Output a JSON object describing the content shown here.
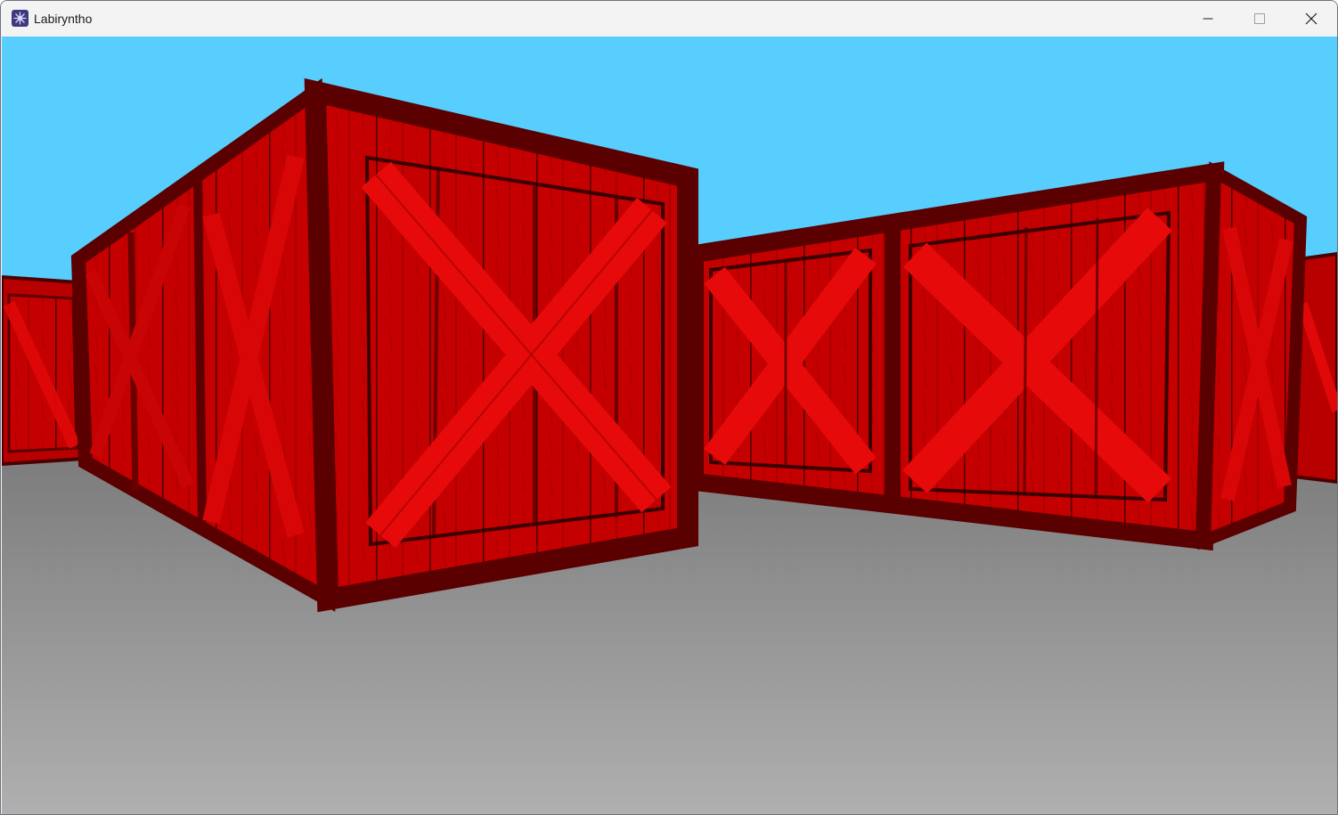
{
  "window": {
    "title": "Labiryntho",
    "icon": "app-icon",
    "controls": {
      "minimize_icon": "minimize-icon",
      "maximize_icon": "maximize-icon",
      "close_icon": "close-icon"
    }
  },
  "scene": {
    "sky_color": "#57cefd",
    "floor_color_top": "#7c7c7c",
    "floor_color_bottom": "#b0b0b0",
    "crate_color": "#c40000",
    "crate_dark": "#5a0000",
    "crate_light": "#e60a0a"
  }
}
